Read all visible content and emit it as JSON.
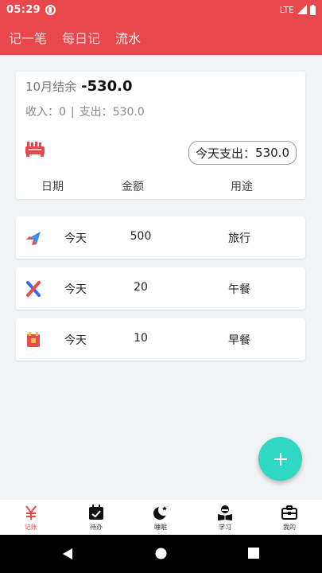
{
  "status_bar": {
    "time": "05:29",
    "network": "LTE"
  },
  "tabs": [
    {
      "label": "记一笔",
      "active": false
    },
    {
      "label": "每日记",
      "active": false
    },
    {
      "label": "流水",
      "active": true
    }
  ],
  "summary": {
    "balance_label": "10月结余",
    "balance_value": "-530.0",
    "income_label": "收入：",
    "income_value": "0",
    "separator": "|",
    "expense_label": "支出：",
    "expense_value": "530.0",
    "today_expense_label": "今天支出：",
    "today_expense_value": "530.0",
    "columns": {
      "date": "日期",
      "amount": "金额",
      "usage": "用途"
    }
  },
  "entries": [
    {
      "icon": "airplane-icon",
      "date": "今天",
      "amount": "500",
      "usage": "旅行"
    },
    {
      "icon": "fork-knife-icon",
      "date": "今天",
      "amount": "20",
      "usage": "午餐"
    },
    {
      "icon": "bread-box-icon",
      "date": "今天",
      "amount": "10",
      "usage": "早餐"
    }
  ],
  "bottom_nav": [
    {
      "label": "记账",
      "icon": "yen-icon",
      "active": true
    },
    {
      "label": "待办",
      "icon": "calendar-check-icon",
      "active": false
    },
    {
      "label": "睡眠",
      "icon": "moon-icon",
      "active": false
    },
    {
      "label": "学习",
      "icon": "reading-icon",
      "active": false
    },
    {
      "label": "我的",
      "icon": "briefcase-icon",
      "active": false
    }
  ],
  "colors": {
    "accent": "#e8474c",
    "fab": "#2ed8c3",
    "background": "#f2f3f5"
  }
}
